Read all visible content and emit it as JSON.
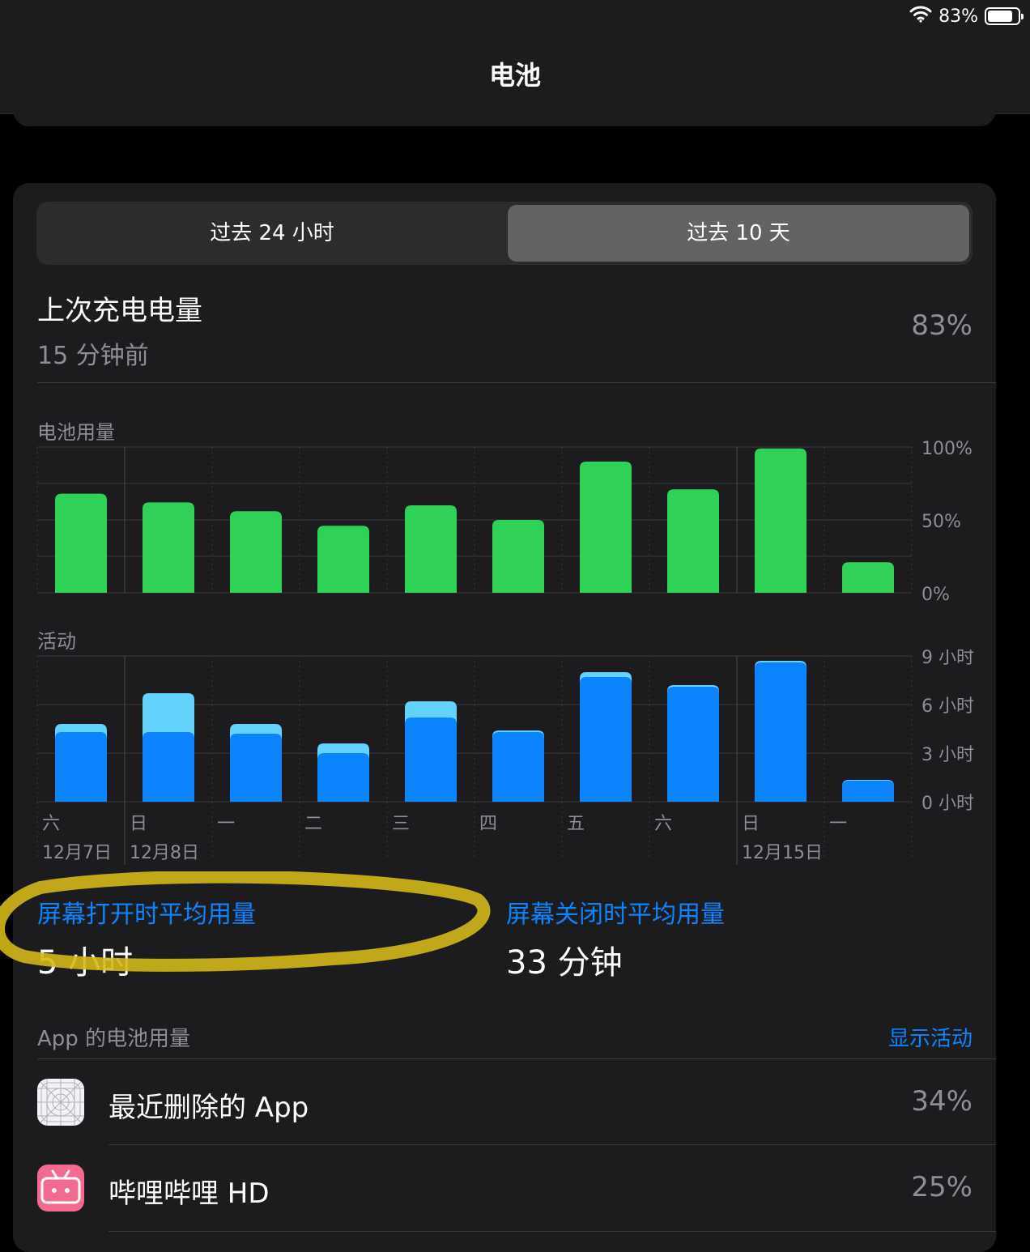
{
  "status": {
    "battery_text": "83%",
    "battery_level": 0.83
  },
  "header": {
    "title": "电池"
  },
  "segment": {
    "tab_24h": "过去 24 小时",
    "tab_10d": "过去 10 天",
    "active": "tab_10d"
  },
  "last_charge": {
    "label": "上次充电电量",
    "time": "15 分钟前",
    "value": "83%"
  },
  "usage_label": "电池用量",
  "activity_label": "活动",
  "chart_data": [
    {
      "type": "bar",
      "categories": [
        "六",
        "日",
        "一",
        "二",
        "三",
        "四",
        "五",
        "六",
        "日",
        "一"
      ],
      "values": [
        68,
        62,
        56,
        46,
        60,
        50,
        90,
        71,
        99,
        21
      ],
      "ylim": [
        0,
        100
      ],
      "ytick_labels": [
        "100%",
        "50%",
        "0%"
      ],
      "color": "#30d158"
    },
    {
      "type": "bar",
      "categories": [
        "六",
        "日",
        "一",
        "二",
        "三",
        "四",
        "五",
        "六",
        "日",
        "一"
      ],
      "series": [
        {
          "values": [
            4.3,
            4.3,
            4.2,
            3.0,
            5.2,
            4.3,
            7.7,
            7.1,
            8.6,
            1.3
          ],
          "color": "#0a84ff"
        },
        {
          "values": [
            0.5,
            2.4,
            0.6,
            0.6,
            1.0,
            0.1,
            0.3,
            0.1,
            0.1,
            0.05
          ],
          "color": "#64d2ff"
        }
      ],
      "stacked": true,
      "ylim": [
        0,
        9
      ],
      "ytick_labels": [
        "9 小时",
        "6 小时",
        "3 小时",
        "0 小时"
      ]
    }
  ],
  "date_labels": [
    "12月7日",
    "12月8日",
    "12月15日"
  ],
  "stats": {
    "screen_on_label": "屏幕打开时平均用量",
    "screen_on_value": "5 小时",
    "screen_off_label": "屏幕关闭时平均用量",
    "screen_off_value": "33 分钟"
  },
  "apps_header": "App 的电池用量",
  "show_activity": "显示活动",
  "apps": [
    {
      "name": "最近删除的 App",
      "percent": "34%",
      "icon": "deleted-app-icon"
    },
    {
      "name": "哔哩哔哩 HD",
      "percent": "25%",
      "icon": "bilibili-icon"
    }
  ],
  "colors": {
    "accent": "#0a84ff",
    "green": "#30d158",
    "light_blue": "#64d2ff",
    "highlight": "#d4b81a"
  }
}
